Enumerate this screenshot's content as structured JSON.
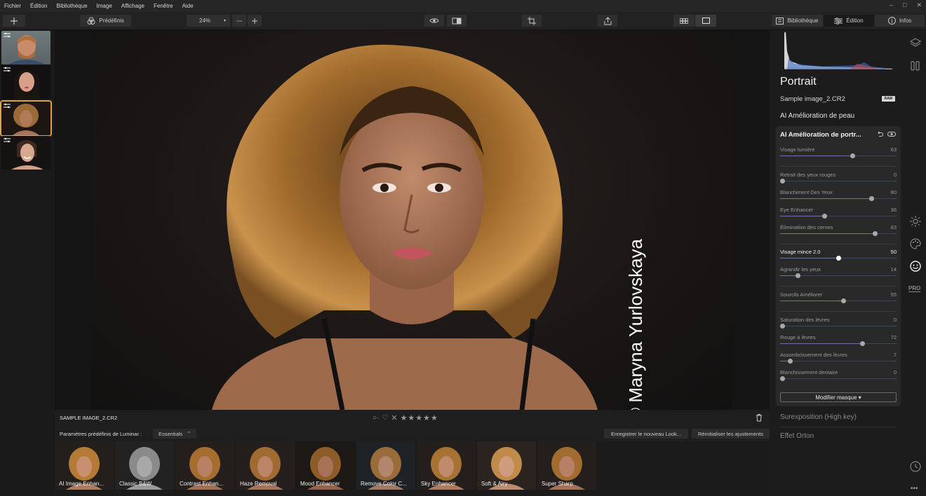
{
  "menu": [
    "Fichier",
    "Édition",
    "Bibliothèque",
    "Image",
    "Affichage",
    "Fenêtre",
    "Aide"
  ],
  "window_controls": [
    "–",
    "□",
    "✕"
  ],
  "toolbar": {
    "presets_label": "Prédéfinis",
    "zoom": "24%",
    "library_tab": "Bibliothèque",
    "edit_tab": "Édition",
    "info_tab": "Infos"
  },
  "filmstrip": [
    {
      "name": "man-portrait",
      "selected": false
    },
    {
      "name": "woman-portrait-1",
      "selected": false
    },
    {
      "name": "woman-portrait-curly",
      "selected": true
    },
    {
      "name": "woman-portrait-smile",
      "selected": false
    }
  ],
  "canvas": {
    "watermark": "© Maryna Yurlovskaya"
  },
  "infobar": {
    "file_name": "SAMPLE IMAGE_2.CR2",
    "stars": 5
  },
  "presets": {
    "label": "Paramètres prédéfinis de Luminar :",
    "category": "Essentials",
    "save_look": "Enregistrer le nouveau Look...",
    "reset": "Réinitialiser les ajustements",
    "tiles": [
      "AI Image Enhan...",
      "Classic B&W",
      "Contrast Enhan...",
      "Haze Removal",
      "Mood Enhancer",
      "Remove Color C...",
      "Sky Enhancer",
      "Soft & Airy",
      "Super Sharp"
    ]
  },
  "panel": {
    "title": "Portrait",
    "image_name": "Sample image_2.CR2",
    "raw_badge": "RAW",
    "skin_section": "AI Amélioration de peau",
    "card_title": "AI Amélioration de portr...",
    "sliders": [
      {
        "label": "Visage lumière",
        "value": 63
      },
      {
        "label": "Retrait des yeux rouges",
        "value": 0
      },
      {
        "label": "Blanchiment Des Yeux",
        "value": 80
      },
      {
        "label": "Eye Enhancer",
        "value": 38
      },
      {
        "label": "Élimination des cernes",
        "value": 83
      },
      {
        "label": "Visage mince 2.0",
        "value": 50
      },
      {
        "label": "Agrandir les yeux",
        "value": 14
      },
      {
        "label": "Sourcils Améliorer",
        "value": 55
      },
      {
        "label": "Saturation des lèvres",
        "value": 0
      },
      {
        "label": "Rouge à lèvres",
        "value": 72
      },
      {
        "label": "Assombrissement des lèvres",
        "value": 7
      },
      {
        "label": "Blanchissement dentaire",
        "value": 0
      }
    ],
    "mask_button": "Modifier masque ▾",
    "high_key": "Surexposition (High key)",
    "orton": "Effet Orton",
    "pro_badge": "PRO"
  }
}
